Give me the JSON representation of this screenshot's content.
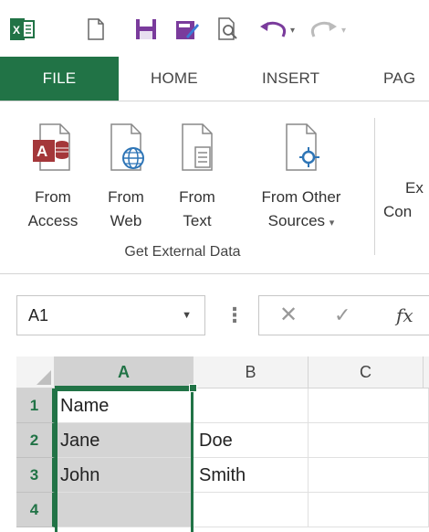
{
  "qat": {
    "icons": [
      "excel-logo-icon",
      "new-document-icon",
      "save-icon",
      "edit-icon",
      "print-preview-icon",
      "undo-icon",
      "redo-icon"
    ]
  },
  "tabs": [
    {
      "label": "FILE",
      "active": true
    },
    {
      "label": "HOME"
    },
    {
      "label": "INSERT"
    },
    {
      "label": "PAG"
    }
  ],
  "ribbon": {
    "group_label": "Get External Data",
    "buttons": [
      {
        "line1": "From",
        "line2": "Access",
        "icon": "access-db-icon"
      },
      {
        "line1": "From",
        "line2": "Web",
        "icon": "web-globe-icon"
      },
      {
        "line1": "From",
        "line2": "Text",
        "icon": "text-file-icon"
      },
      {
        "line1": "From Other",
        "line2": "Sources",
        "icon": "other-sources-icon",
        "dropdown": "▾"
      }
    ],
    "partial": {
      "line1": "Ex",
      "line2": "Con"
    }
  },
  "formula_bar": {
    "name_box": "A1",
    "name_arrow": "▼",
    "separator": "⋮",
    "cancel": "✕",
    "enter": "✓",
    "fx": "fx"
  },
  "sheet": {
    "columns": [
      "A",
      "B",
      "C"
    ],
    "rows": [
      {
        "num": "1",
        "cells": [
          "Name",
          "",
          ""
        ]
      },
      {
        "num": "2",
        "cells": [
          "Jane",
          "Doe",
          ""
        ]
      },
      {
        "num": "3",
        "cells": [
          "John",
          "Smith",
          ""
        ]
      },
      {
        "num": "4",
        "cells": [
          "",
          "",
          ""
        ]
      }
    ]
  },
  "colors": {
    "accent": "#217346",
    "selection_fill": "#d4d4d4"
  }
}
